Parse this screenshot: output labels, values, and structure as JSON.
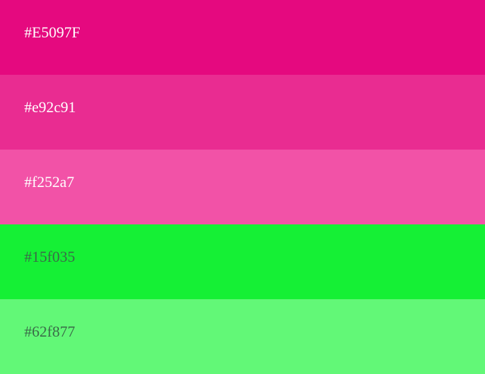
{
  "swatches": [
    {
      "label": "#E5097F",
      "color": "#E5097F",
      "text_color": "#ffffff"
    },
    {
      "label": "#e92c91",
      "color": "#e92c91",
      "text_color": "#ffffff"
    },
    {
      "label": "#f252a7",
      "color": "#f252a7",
      "text_color": "#ffffff"
    },
    {
      "label": "#15f035",
      "color": "#15f035",
      "text_color": "#3a6b48"
    },
    {
      "label": "#62f877",
      "color": "#62f877",
      "text_color": "#3a6b48"
    }
  ]
}
